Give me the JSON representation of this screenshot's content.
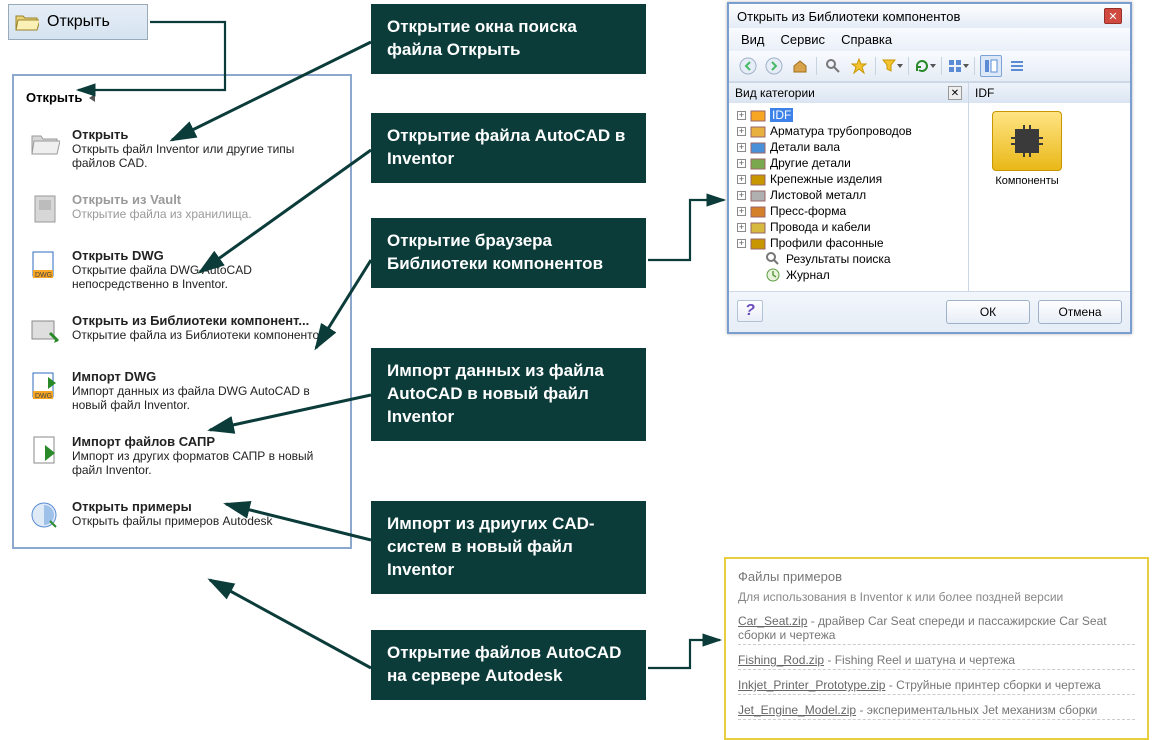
{
  "topButton": {
    "label": "Открыть"
  },
  "openPanel": {
    "title": "Открыть",
    "items": [
      {
        "title": "Открыть",
        "desc": "Открыть файл Inventor или другие типы файлов CAD.",
        "icon": "folder",
        "dim": false
      },
      {
        "title": "Открыть из Vault",
        "desc": "Открытие файла из хранилища.",
        "icon": "vault",
        "dim": true
      },
      {
        "title": "Открыть DWG",
        "desc": "Открытие файла DWG AutoCAD непосредственно в Inventor.",
        "icon": "dwg",
        "dim": false
      },
      {
        "title": "Открыть из Библиотеки компонент...",
        "desc": "Открытие файла из Библиотеки компонентов.",
        "icon": "lib",
        "dim": false
      },
      {
        "title": "Импорт DWG",
        "desc": "Импорт данных из файла DWG AutoCAD в новый файл Inventor.",
        "icon": "dwgimp",
        "dim": false
      },
      {
        "title": "Импорт файлов САПР",
        "desc": "Импорт из других форматов САПР в новый файл Inventor.",
        "icon": "capr",
        "dim": false
      },
      {
        "title": "Открыть примеры",
        "desc": "Открыть файлы примеров Autodesk",
        "icon": "sample",
        "dim": false
      }
    ]
  },
  "callouts": [
    "Открытие окна поиска файла Открыть",
    "Открытие файла AutoCAD в Inventor",
    "Открытие браузера Библиотеки компонентов",
    "Импорт данных из файла  AutoCAD  в новый файл Inventor",
    "Импорт из дриугих CAD-систем  в новый файл Inventor",
    "Открытие файлов  AutoCAD  на сервере Autodesk"
  ],
  "library": {
    "title": "Открыть из Библиотеки компонентов",
    "menu": [
      "Вид",
      "Сервис",
      "Справка"
    ],
    "treeHeader": "Вид категории",
    "listHeader": "IDF",
    "tree": [
      {
        "label": "IDF",
        "sel": true
      },
      {
        "label": "Арматура трубопроводов"
      },
      {
        "label": "Детали вала"
      },
      {
        "label": "Другие детали"
      },
      {
        "label": "Крепежные изделия"
      },
      {
        "label": "Листовой металл"
      },
      {
        "label": "Пресс-форма"
      },
      {
        "label": "Провода и кабели"
      },
      {
        "label": "Профили фасонные"
      }
    ],
    "treeExtra": [
      {
        "label": "Результаты поиска",
        "icon": "search"
      },
      {
        "label": "Журнал",
        "icon": "history"
      }
    ],
    "listItem": "Компоненты",
    "ok": "ОК",
    "cancel": "Отмена"
  },
  "samples": {
    "title": "Файлы примеров",
    "sub": "Для использования в Inventor к или более поздней версии",
    "items": [
      {
        "file": "Car_Seat.zip",
        "desc": " - драйвер Car Seat спереди и пассажирские Car Seat сборки и чертежа"
      },
      {
        "file": "Fishing_Rod.zip",
        "desc": " - Fishing Reel и шатуна и чертежа"
      },
      {
        "file": "Inkjet_Printer_Prototype.zip",
        "desc": " - Струйные принтер сборки и чертежа"
      },
      {
        "file": "Jet_Engine_Model.zip",
        "desc": " - экспериментальных Jet механизм сборки"
      }
    ]
  }
}
